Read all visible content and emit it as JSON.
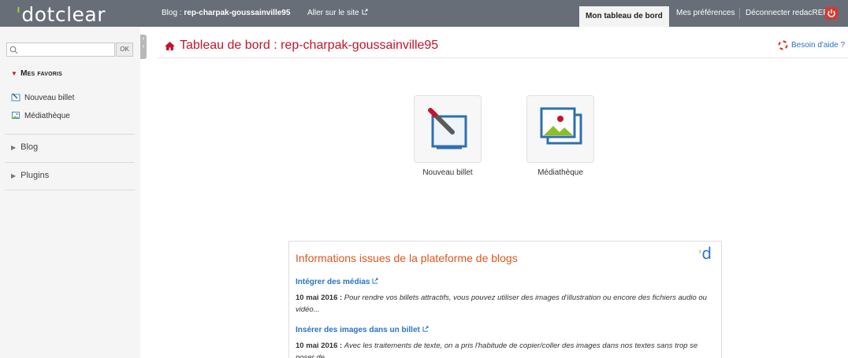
{
  "app": {
    "logo": "dotclear",
    "blog_label": "Blog : ",
    "blog_name": "rep-charpak-goussainville95",
    "goto_site": "Aller sur le site"
  },
  "topnav": {
    "dashboard": "Mon tableau de bord",
    "preferences": "Mes préférences",
    "logout": "Déconnecter redacREP"
  },
  "sidebar": {
    "search": {
      "value": "",
      "placeholder": "",
      "button": "OK"
    },
    "favorites_title": "Mes favoris",
    "favorites": [
      {
        "label": "Nouveau billet",
        "icon": "new-post-icon"
      },
      {
        "label": "Médiathèque",
        "icon": "media-icon"
      }
    ],
    "sections": [
      {
        "label": "Blog"
      },
      {
        "label": "Plugins"
      }
    ]
  },
  "main": {
    "title": "Tableau de bord : rep-charpak-goussainville95",
    "help": "Besoin d'aide ?",
    "tiles": [
      {
        "label": "Nouveau billet",
        "icon": "new-post-icon"
      },
      {
        "label": "Médiathèque",
        "icon": "media-icon"
      }
    ]
  },
  "news": {
    "title": "Informations issues de la plateforme de blogs",
    "items": [
      {
        "link": "Intégrer des médias",
        "date": "10 mai 2016 :",
        "text": "Pour rendre vos billets attractifs, vous pouvez utiliser des images d'illustration ou encore des fichiers audio ou vidéo..."
      },
      {
        "link": "Insérer des images dans un billet",
        "date": "10 mai 2016 :",
        "text": "Avec les traitements de texte, on a pris l'habitude de copier/coller des images dans nos textes sans trop se poser de"
      }
    ]
  },
  "colors": {
    "topbar": "#676e78",
    "accent": "#c4142b",
    "link": "#2a73c5",
    "news_title": "#e0561e",
    "logo_dot": "#a2cb3a"
  }
}
